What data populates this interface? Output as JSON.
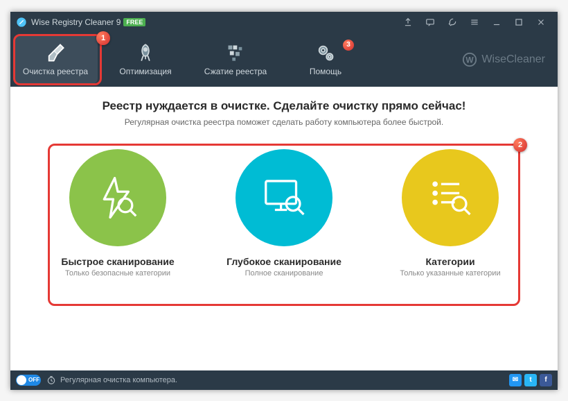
{
  "titlebar": {
    "title": "Wise Registry Cleaner 9",
    "badge": "FREE"
  },
  "menu": {
    "items": [
      {
        "label": "Очистка реестра"
      },
      {
        "label": "Оптимизация"
      },
      {
        "label": "Сжатие реестра"
      },
      {
        "label": "Помощь"
      }
    ],
    "help_badge": "3"
  },
  "brand": "WiseCleaner",
  "content": {
    "headline": "Реестр нуждается в очистке. Сделайте очистку прямо сейчас!",
    "subline": "Регулярная очистка реестра поможет сделать работу компьютера более быстрой.",
    "options": [
      {
        "title": "Быстрое сканирование",
        "sub": "Только безопасные категории"
      },
      {
        "title": "Глубокое сканирование",
        "sub": "Полное сканирование"
      },
      {
        "title": "Категории",
        "sub": "Только указанные категории"
      }
    ]
  },
  "statusbar": {
    "toggle": "OFF",
    "text": "Регулярная очистка компьютера."
  },
  "callouts": {
    "one": "1",
    "two": "2"
  },
  "colors": {
    "green": "#8bc34a",
    "teal": "#00bcd4",
    "yellow": "#e8c81d",
    "red": "#e53935"
  }
}
